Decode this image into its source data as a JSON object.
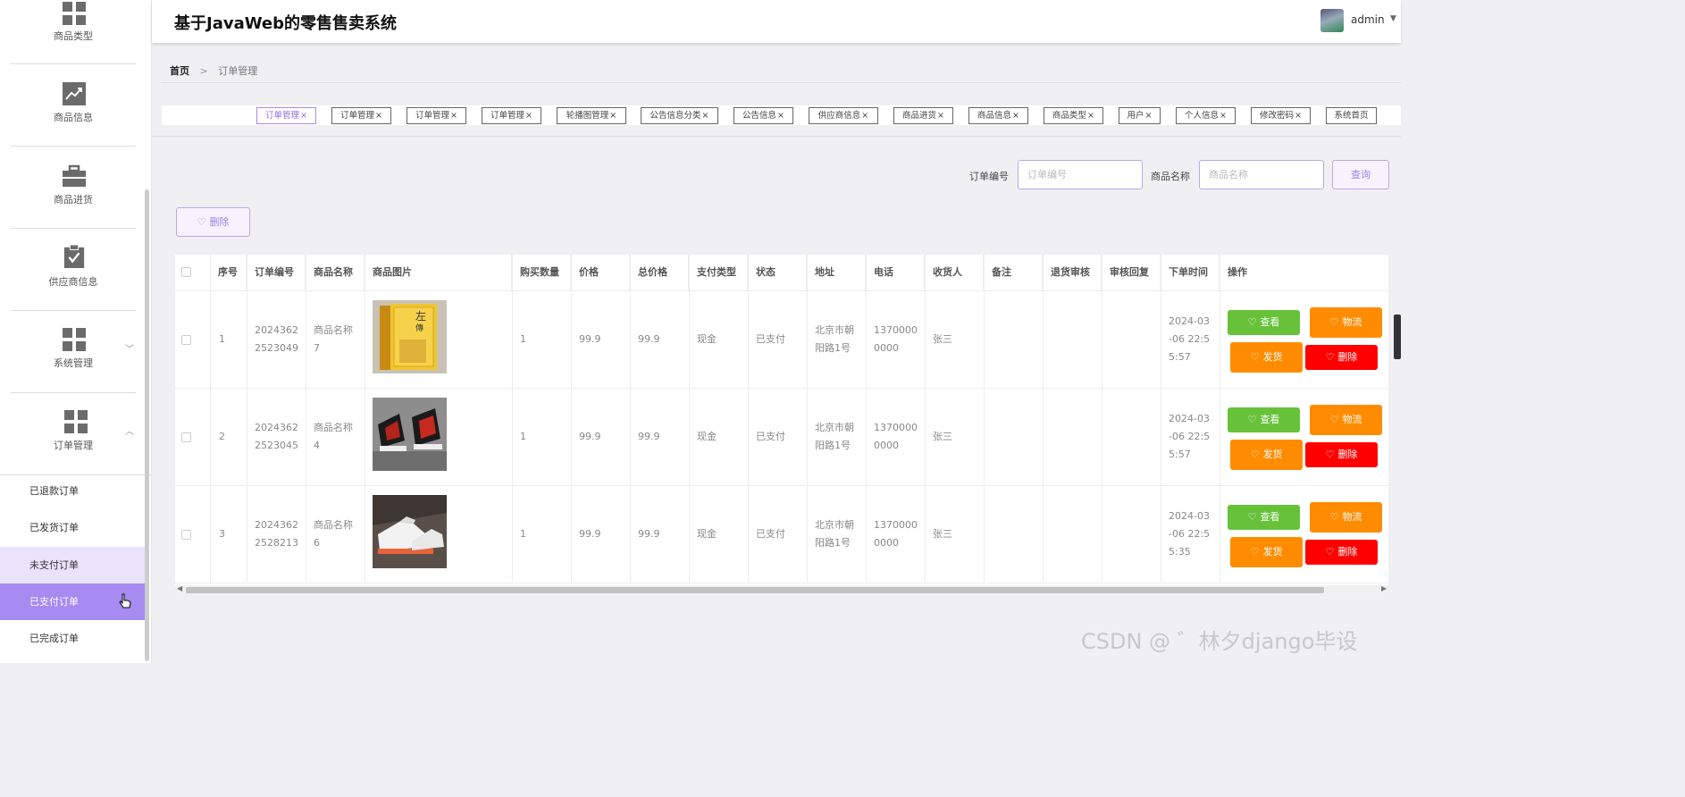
{
  "app": {
    "title": "基于JavaWeb的零售售卖系统",
    "user": "admin"
  },
  "sidebar": {
    "items": [
      {
        "label": "商品类型",
        "icon": "grid-icon"
      },
      {
        "label": "商品信息",
        "icon": "trend-chart-icon"
      },
      {
        "label": "商品进货",
        "icon": "briefcase-icon"
      },
      {
        "label": "供应商信息",
        "icon": "clipboard-check-icon"
      },
      {
        "label": "系统管理",
        "icon": "grid-icon"
      },
      {
        "label": "订单管理",
        "icon": "grid-icon"
      }
    ],
    "sub_items": [
      "已退款订单",
      "已发货订单",
      "未支付订单",
      "已支付订单",
      "已完成订单"
    ],
    "active_sub": "已支付订单",
    "hover_sub": "未支付订单"
  },
  "breadcrumb": {
    "home": "首页",
    "separator": ">",
    "current": "订单管理"
  },
  "tags": [
    "订单管理",
    "订单管理",
    "订单管理",
    "订单管理",
    "轮播图管理",
    "公告信息分类",
    "公告信息",
    "供应商信息",
    "商品进货",
    "商品信息",
    "商品类型",
    "用户",
    "个人信息",
    "修改密码",
    "系统首页"
  ],
  "tag_close": "×",
  "search": {
    "order_no_label": "订单编号",
    "order_no_placeholder": "订单编号",
    "product_name_label": "商品名称",
    "product_name_placeholder": "商品名称",
    "query_button": "查询"
  },
  "toolbar": {
    "delete_button": "删除"
  },
  "table": {
    "headers": [
      "序号",
      "订单编号",
      "商品名称",
      "商品图片",
      "购买数量",
      "价格",
      "总价格",
      "支付类型",
      "状态",
      "地址",
      "电话",
      "收货人",
      "备注",
      "退货审核",
      "审核回复",
      "下单时间",
      "操作"
    ],
    "rows": [
      {
        "index": "1",
        "order_no_1": "2024362",
        "order_no_2": "2523049",
        "name_1": "商品名称",
        "name_2": "7",
        "image": "book",
        "qty": "1",
        "price": "99.9",
        "total": "99.9",
        "pay": "现金",
        "status": "已支付",
        "addr_1": "北京市朝",
        "addr_2": "阳路1号",
        "phone_1": "1370000",
        "phone_2": "0000",
        "receiver": "张三",
        "note": "",
        "return_audit": "",
        "audit_reply": "",
        "time_1": "2024-03",
        "time_2": "-06 22:5",
        "time_3": "5:57"
      },
      {
        "index": "2",
        "order_no_1": "2024362",
        "order_no_2": "2523045",
        "name_1": "商品名称",
        "name_2": "4",
        "image": "black-red-sneaker",
        "qty": "1",
        "price": "99.9",
        "total": "99.9",
        "pay": "现金",
        "status": "已支付",
        "addr_1": "北京市朝",
        "addr_2": "阳路1号",
        "phone_1": "1370000",
        "phone_2": "0000",
        "receiver": "张三",
        "note": "",
        "return_audit": "",
        "audit_reply": "",
        "time_1": "2024-03",
        "time_2": "-06 22:5",
        "time_3": "5:57"
      },
      {
        "index": "3",
        "order_no_1": "2024362",
        "order_no_2": "2528213",
        "name_1": "商品名称",
        "name_2": "6",
        "image": "white-sneaker",
        "qty": "1",
        "price": "99.9",
        "total": "99.9",
        "pay": "现金",
        "status": "已支付",
        "addr_1": "北京市朝",
        "addr_2": "阳路1号",
        "phone_1": "1370000",
        "phone_2": "0000",
        "receiver": "张三",
        "note": "",
        "return_audit": "",
        "audit_reply": "",
        "time_1": "2024-03",
        "time_2": "-06 22:5",
        "time_3": "5:35"
      }
    ],
    "actions": {
      "view": "查看",
      "logistics": "物流",
      "ship": "发货",
      "delete": "删除"
    }
  },
  "colors": {
    "accent": "#a78bf0",
    "view": "#67c23a",
    "logistics": "#ff8c00",
    "ship": "#ff8c00",
    "delete": "#ff0000"
  },
  "watermark": "CSDN @ ゛林夕django毕设"
}
